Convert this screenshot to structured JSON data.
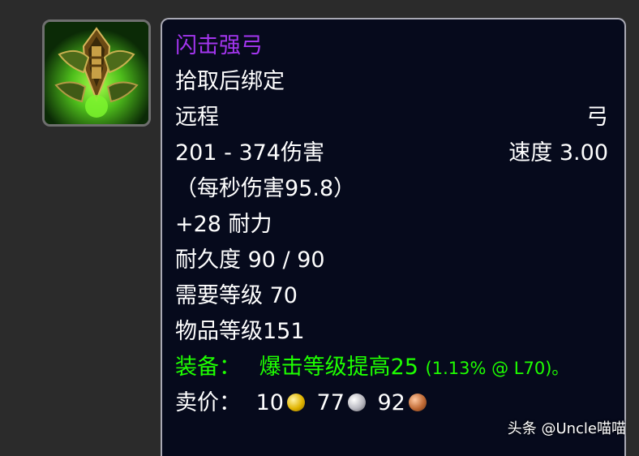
{
  "item": {
    "name": "闪击强弓",
    "binding": "拾取后绑定",
    "slot": "远程",
    "type": "弓",
    "damage": "201 - 374伤害",
    "speed": "速度 3.00",
    "dps": "（每秒伤害95.8）",
    "stat": "+28 耐力",
    "durability": "耐久度 90 / 90",
    "required_level": "需要等级 70",
    "item_level": "物品等级151",
    "equip_label": "装备：",
    "equip_effect": "爆击等级提高25",
    "equip_detail": "(1.13% @ L70)。",
    "sell_label": "卖价：",
    "sell_gold": "10",
    "sell_silver": "77",
    "sell_copper": "92"
  },
  "colors": {
    "epic_name": "#a335ee",
    "equip_green": "#1eff00",
    "tooltip_bg": "#060a1c",
    "tooltip_border": "#a9a9b4"
  },
  "icons": [
    "bow-icon",
    "gold-coin-icon",
    "silver-coin-icon",
    "copper-coin-icon"
  ],
  "watermark": "头条 @Uncle喵喵"
}
